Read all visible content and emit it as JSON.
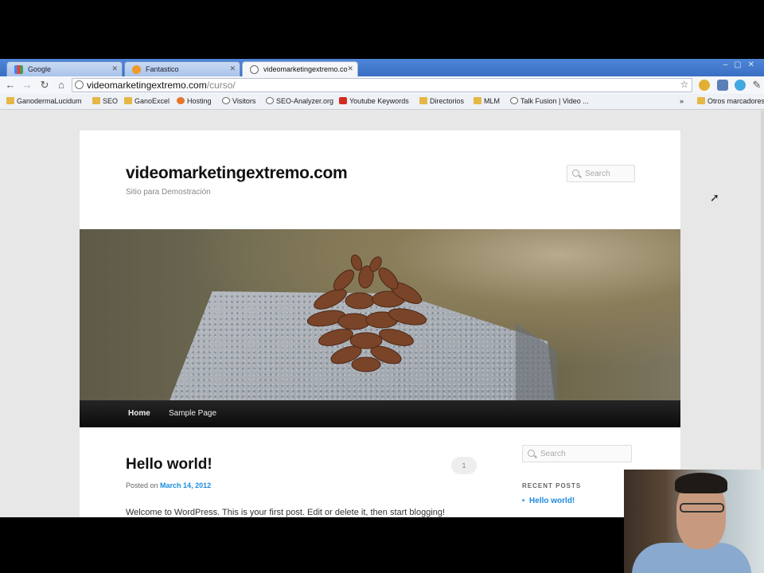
{
  "browser": {
    "tabs": [
      {
        "label": "Google",
        "active": false
      },
      {
        "label": "Fantastico",
        "active": false
      },
      {
        "label": "videomarketingextremo.co",
        "active": true
      }
    ],
    "address": {
      "host": "videomarketingextremo.com",
      "path": "/curso/"
    },
    "bookmarks": [
      {
        "label": "GanodermaLucidum",
        "icon": "folder-icon"
      },
      {
        "label": "SEO",
        "icon": "folder-icon"
      },
      {
        "label": "GanoExcel",
        "icon": "folder-icon"
      },
      {
        "label": "Hosting",
        "icon": "hosting-icon"
      },
      {
        "label": "Visitors",
        "icon": "globe-icon"
      },
      {
        "label": "SEO-Analyzer.org",
        "icon": "globe-icon"
      },
      {
        "label": "Youtube Keywords",
        "icon": "youtube-icon"
      },
      {
        "label": "Directorios",
        "icon": "folder-icon"
      },
      {
        "label": "MLM",
        "icon": "folder-icon"
      },
      {
        "label": "Talk Fusion | Video ...",
        "icon": "globe-icon"
      }
    ],
    "overflow_label": "»",
    "other_bookmarks": "Otros marcadores"
  },
  "site": {
    "title": "videomarketingextremo.com",
    "description": "Sitio para Demostración",
    "search_placeholder": "Search"
  },
  "menu": [
    {
      "label": "Home",
      "current": true
    },
    {
      "label": "Sample Page",
      "current": false
    }
  ],
  "post": {
    "title": "Hello world!",
    "comments": "1",
    "posted_on": "Posted on",
    "date": "March 14, 2012",
    "excerpt": "Welcome to WordPress. This is your first post. Edit or delete it, then start blogging!"
  },
  "sidebar": {
    "search_placeholder": "Search",
    "recent_title": "RECENT POSTS",
    "recent_posts": [
      "Hello world!"
    ]
  },
  "colors": {
    "tabstrip": "#3a6fc4",
    "link": "#1b8be0",
    "menu_bar": "#111111"
  }
}
